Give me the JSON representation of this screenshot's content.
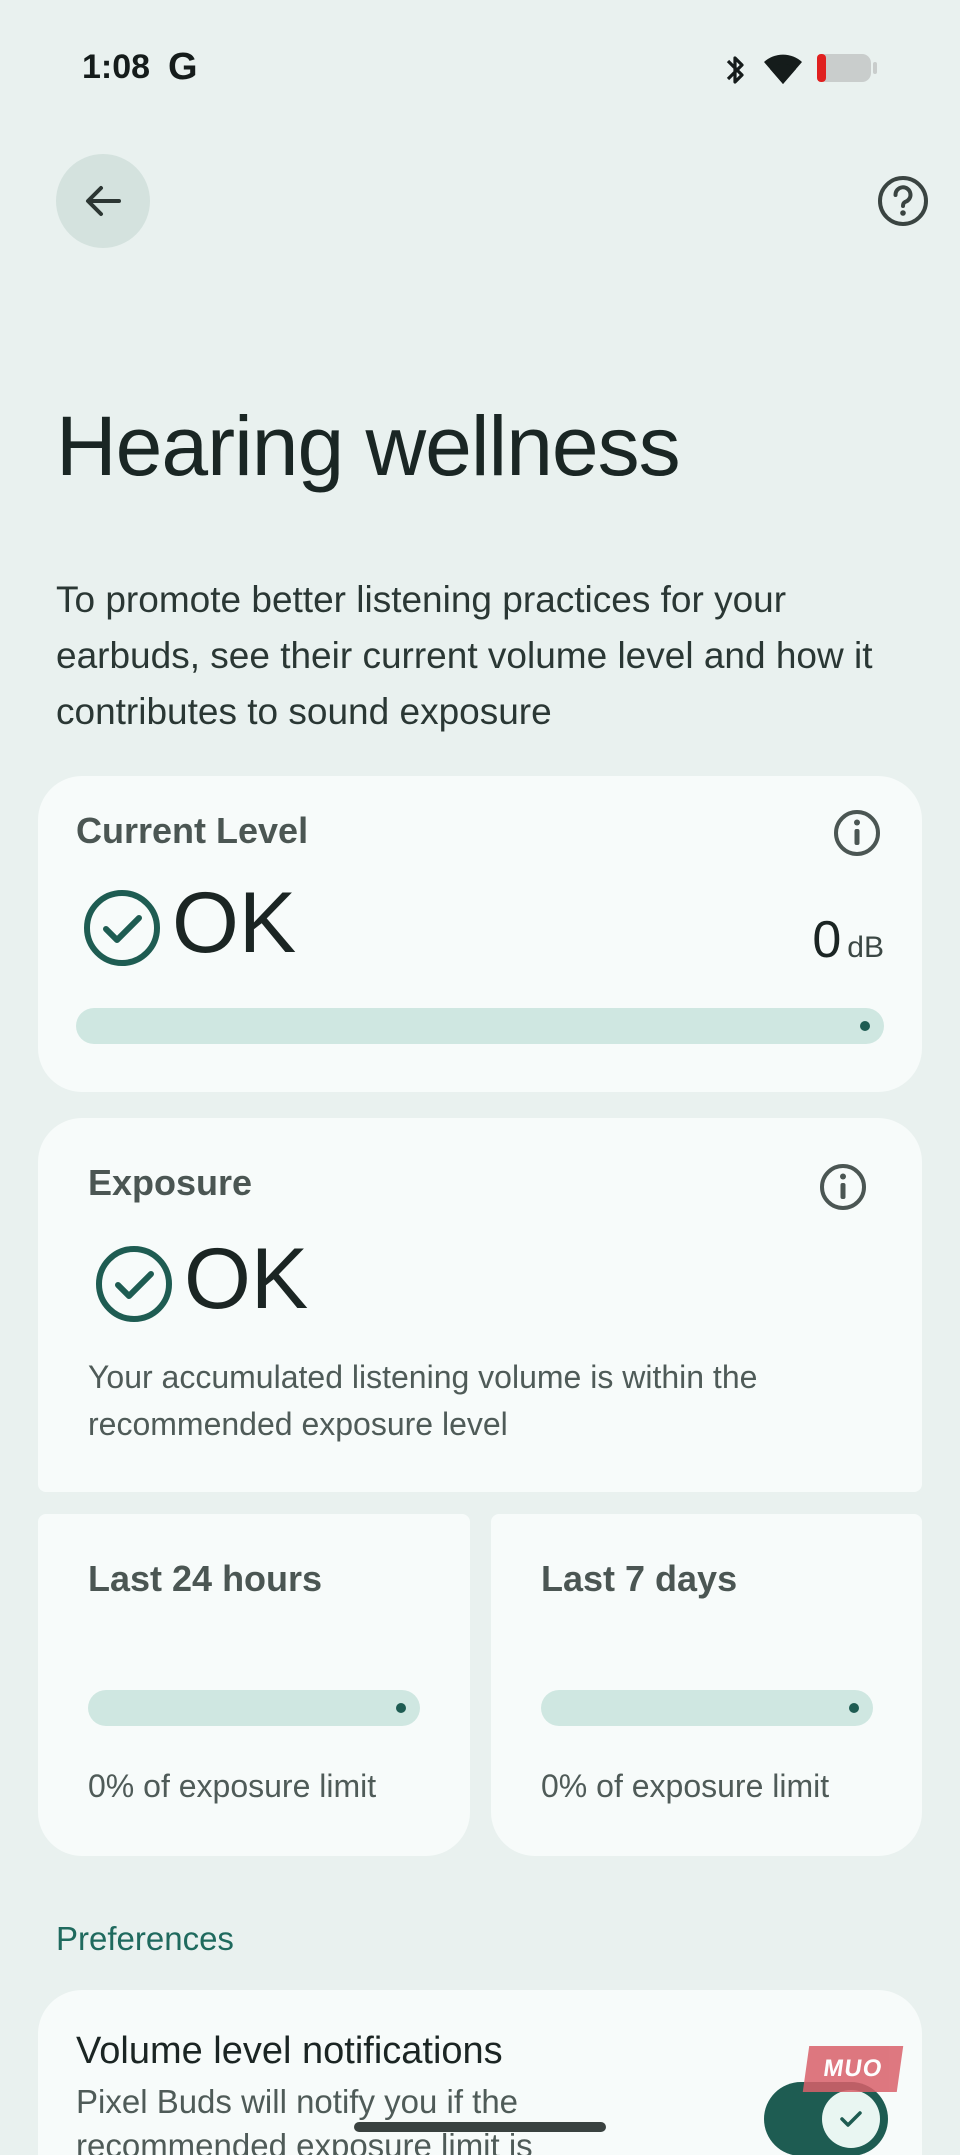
{
  "status_bar": {
    "time": "1:08",
    "google_badge": "G",
    "icons": [
      "bluetooth-icon",
      "wifi-icon",
      "battery-icon"
    ]
  },
  "app_bar": {
    "back_icon": "arrow-back-icon",
    "help_icon": "help-icon"
  },
  "page": {
    "title": "Hearing wellness",
    "description": "To promote better listening practices for your earbuds, see their current volume level and how it contributes to sound exposure"
  },
  "current_level": {
    "title": "Current Level",
    "status": "OK",
    "value": "0",
    "unit": "dB",
    "level_fraction": 0
  },
  "exposure": {
    "title": "Exposure",
    "status": "OK",
    "description": "Your accumulated listening volume is within the recommended exposure level"
  },
  "last_24h": {
    "title": "Last 24 hours",
    "limit_text": "0% of exposure limit",
    "percent": 0
  },
  "last_7d": {
    "title": "Last 7 days",
    "limit_text": "0% of exposure limit",
    "percent": 0
  },
  "preferences": {
    "header": "Preferences",
    "notifications": {
      "title": "Volume level notifications",
      "description": "Pixel Buds will notify you if the recommended exposure limit is",
      "enabled": true
    }
  },
  "watermark": "MUO",
  "colors": {
    "accent": "#1e5c52",
    "bar": "#cfe7e1",
    "background": "#e9f1ef",
    "card": "#f7fbfa"
  }
}
